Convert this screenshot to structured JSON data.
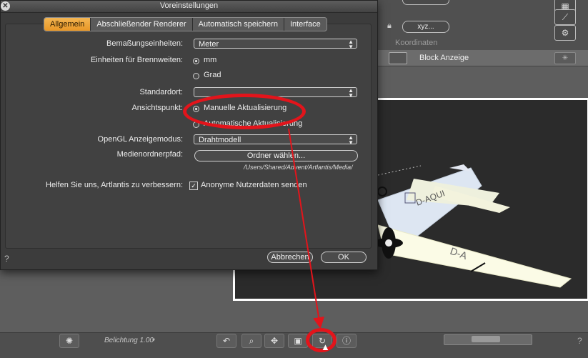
{
  "dialog": {
    "title": "Voreinstellungen",
    "tabs": [
      {
        "label": "Allgemein",
        "active": true
      },
      {
        "label": "Abschließender Renderer",
        "active": false
      },
      {
        "label": "Automatisch speichern",
        "active": false
      },
      {
        "label": "Interface",
        "active": false
      }
    ],
    "fields": {
      "units_label": "Bemaßungseinheiten:",
      "units_value": "Meter",
      "focal_label": "Einheiten für Brennweiten:",
      "focal_options": [
        {
          "label": "mm",
          "selected": true
        },
        {
          "label": "Grad",
          "selected": false
        }
      ],
      "location_label": "Standardort:",
      "location_value": "",
      "viewpoint_label": "Ansichtspunkt:",
      "viewpoint_options": [
        {
          "label": "Manuelle Aktualisierung",
          "selected": true
        },
        {
          "label": "Automatische Aktualisierung",
          "selected": false
        }
      ],
      "opengl_label": "OpenGL Anzeigemodus:",
      "opengl_value": "Drahtmodell",
      "media_label": "Medienordnerpfad:",
      "media_button": "Ordner wählen...",
      "media_path": "/Users/Shared/Advent/Artlantis/Media/",
      "improve_label": "Helfen Sie uns, Artlantis zu verbessern:",
      "improve_option": "Anonyme Nutzerdaten senden",
      "improve_checked": true
    },
    "buttons": {
      "cancel": "Abbrechen",
      "ok": "OK",
      "help": "?"
    }
  },
  "background": {
    "field_value": "xyz...",
    "section_label": "Koordinaten",
    "block_label": "Block Anzeige",
    "exposure": "Belichtung 1.00",
    "help": "?"
  },
  "colors": {
    "accent_tab": "#f0a43a",
    "highlight": "#e3141b"
  }
}
